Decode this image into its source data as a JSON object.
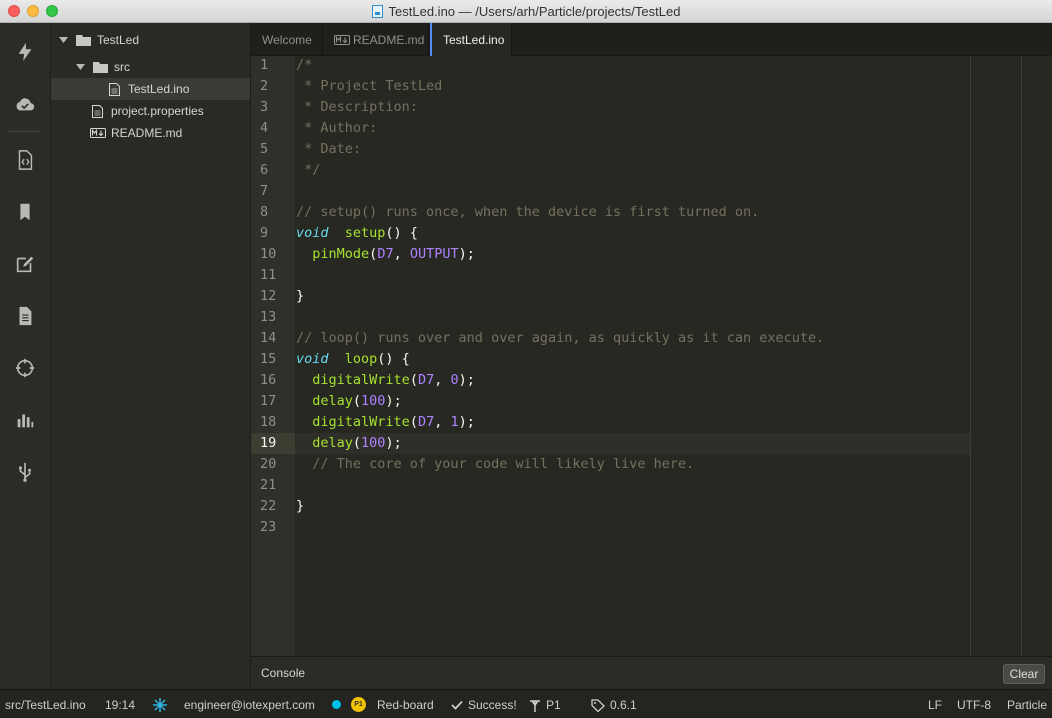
{
  "window": {
    "title": "TestLed.ino — /Users/arh/Particle/projects/TestLed"
  },
  "activity_bar": {
    "icons": [
      "flash-icon",
      "cloud-icon",
      "code-icon",
      "bookmark-icon",
      "edit-icon",
      "document-icon",
      "target-icon",
      "chart-icon",
      "usb-icon"
    ]
  },
  "tree": {
    "root": "TestLed",
    "src_folder": "src",
    "file_ino": "TestLed.ino",
    "file_props": "project.properties",
    "file_readme": "README.md"
  },
  "tabs": [
    "Welcome",
    "README.md",
    "TestLed.ino"
  ],
  "editor": {
    "current_line": 19,
    "lines": [
      "1",
      "2",
      "3",
      "4",
      "5",
      "6",
      "7",
      "8",
      "9",
      "10",
      "11",
      "12",
      "13",
      "14",
      "15",
      "16",
      "17",
      "18",
      "19",
      "20",
      "21",
      "22",
      "23"
    ],
    "code": [
      [
        [
          "c-comment",
          "/*"
        ]
      ],
      [
        [
          "c-comment",
          " * Project TestLed"
        ]
      ],
      [
        [
          "c-comment",
          " * Description:"
        ]
      ],
      [
        [
          "c-comment",
          " * Author:"
        ]
      ],
      [
        [
          "c-comment",
          " * Date:"
        ]
      ],
      [
        [
          "c-comment",
          " */"
        ]
      ],
      [],
      [
        [
          "c-comment",
          "// setup() runs once, when the device is first turned on."
        ]
      ],
      [
        [
          "c-kw",
          "void"
        ],
        [
          "",
          "  "
        ],
        [
          "c-fn",
          "setup"
        ],
        [
          "",
          "() {"
        ]
      ],
      [
        [
          "",
          "  "
        ],
        [
          "c-fn",
          "pinMode"
        ],
        [
          "",
          "("
        ],
        [
          "c-const",
          "D7"
        ],
        [
          "",
          ", "
        ],
        [
          "c-const",
          "OUTPUT"
        ],
        [
          "",
          ");"
        ]
      ],
      [],
      [
        [
          "",
          "}"
        ]
      ],
      [],
      [
        [
          "c-comment",
          "// loop() runs over and over again, as quickly as it can execute."
        ]
      ],
      [
        [
          "c-kw",
          "void"
        ],
        [
          "",
          "  "
        ],
        [
          "c-fn",
          "loop"
        ],
        [
          "",
          "() {"
        ]
      ],
      [
        [
          "",
          "  "
        ],
        [
          "c-fn",
          "digitalWrite"
        ],
        [
          "",
          "("
        ],
        [
          "c-const",
          "D7"
        ],
        [
          "",
          ", "
        ],
        [
          "c-const",
          "0"
        ],
        [
          "",
          ");"
        ]
      ],
      [
        [
          "",
          "  "
        ],
        [
          "c-fn",
          "delay"
        ],
        [
          "",
          "("
        ],
        [
          "c-const",
          "100"
        ],
        [
          "",
          ");"
        ]
      ],
      [
        [
          "",
          "  "
        ],
        [
          "c-fn",
          "digitalWrite"
        ],
        [
          "",
          "("
        ],
        [
          "c-const",
          "D7"
        ],
        [
          "",
          ", "
        ],
        [
          "c-const",
          "1"
        ],
        [
          "",
          ");"
        ]
      ],
      [
        [
          "",
          "  "
        ],
        [
          "c-fn",
          "delay"
        ],
        [
          "",
          "("
        ],
        [
          "c-const",
          "100"
        ],
        [
          "",
          ");"
        ]
      ],
      [
        [
          "",
          "  "
        ],
        [
          "c-comment",
          "// The core of your code will likely live here."
        ]
      ],
      [],
      [
        [
          "",
          "}"
        ]
      ],
      []
    ]
  },
  "console": {
    "title": "Console",
    "clear_label": "Clear"
  },
  "status": {
    "file": "src/TestLed.ino",
    "cursor": "19:14",
    "user": "engineer@iotexpert.com",
    "p1_badge": "P1",
    "device": "Red-board",
    "build_status": "Success!",
    "platform": "P1",
    "version": "0.6.1",
    "line_ending": "LF",
    "encoding": "UTF-8",
    "grammar": "Particle"
  }
}
